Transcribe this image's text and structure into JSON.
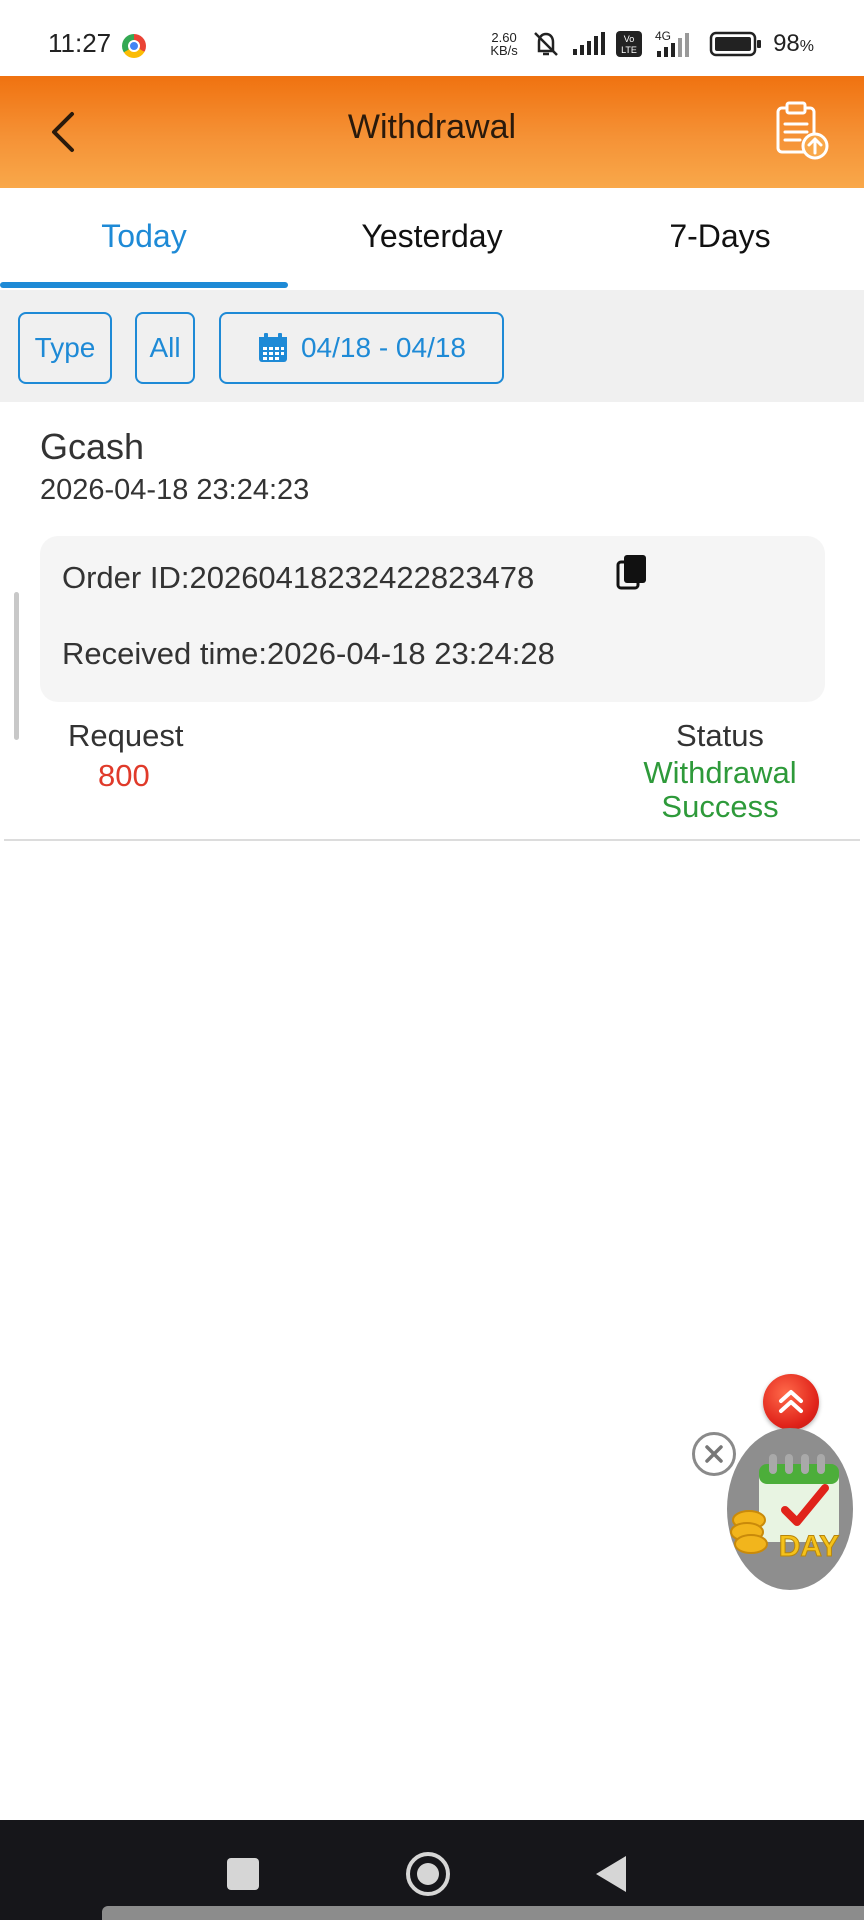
{
  "status_bar": {
    "time": "11:27",
    "net_speed_value": "2.60",
    "net_speed_unit": "KB/s",
    "network_label": "4G",
    "volte_label": "Vo LTE",
    "battery_percent": "98",
    "battery_unit": "%"
  },
  "header": {
    "title": "Withdrawal",
    "back_icon": "chevron-left-icon",
    "action_icon": "clipboard-upload-icon"
  },
  "tabs": [
    {
      "label": "Today",
      "active": true
    },
    {
      "label": "Yesterday",
      "active": false
    },
    {
      "label": "7-Days",
      "active": false
    }
  ],
  "filters": {
    "type_label": "Type",
    "all_label": "All",
    "date_range": "04/18 - 04/18",
    "date_icon": "calendar-icon"
  },
  "records": [
    {
      "method": "Gcash",
      "datetime": "2026-04-18 23:24:23",
      "order_id_text": "Order ID:20260418232422823478",
      "received_text": "Received time:2026-04-18 23:24:28",
      "request_label": "Request",
      "request_value": "800",
      "status_label": "Status",
      "status_value": "Withdrawal Success"
    }
  ],
  "floating": {
    "scroll_top_icon": "double-chevron-up-icon",
    "close_icon": "close-icon",
    "daily_label": "DAY"
  },
  "colors": {
    "header_orange": "#f07210",
    "accent_blue": "#1e8ad6",
    "request_red": "#e03a2a",
    "success_green": "#2e9a3a"
  }
}
